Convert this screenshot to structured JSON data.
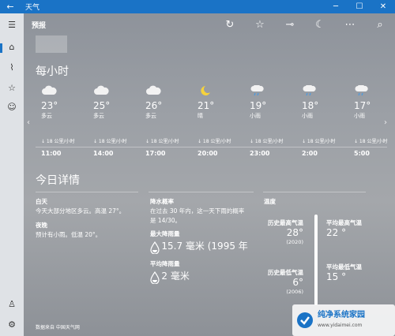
{
  "titlebar": {
    "back": "←",
    "title": "天气",
    "minimize": "─",
    "maximize": "☐",
    "close": "✕"
  },
  "toolbar": {
    "label": "预报"
  },
  "hourly": {
    "title": "每小时",
    "items": [
      {
        "temp": "23°",
        "cond": "多云",
        "wind": "↓ 18 公里/小时",
        "time": "11:00",
        "icon": "cloud-icon"
      },
      {
        "temp": "25°",
        "cond": "多云",
        "wind": "↓ 18 公里/小时",
        "time": "14:00",
        "icon": "cloud-icon"
      },
      {
        "temp": "26°",
        "cond": "多云",
        "wind": "↓ 18 公里/小时",
        "time": "17:00",
        "icon": "cloud-icon"
      },
      {
        "temp": "21°",
        "cond": "晴",
        "wind": "↓ 18 公里/小时",
        "time": "20:00",
        "icon": "moon-icon"
      },
      {
        "temp": "19°",
        "cond": "小雨",
        "wind": "↓ 18 公里/小时",
        "time": "23:00",
        "icon": "rain-icon"
      },
      {
        "temp": "18°",
        "cond": "小雨",
        "wind": "↓ 18 公里/小时",
        "time": "2:00",
        "icon": "rain-icon"
      },
      {
        "temp": "17°",
        "cond": "小雨",
        "wind": "↓ 18 公里/小时",
        "time": "5:00",
        "icon": "rain-icon"
      }
    ]
  },
  "today": {
    "title": "今日详情",
    "day_label": "白天",
    "day_text": "今天大部分地区多云。高温 27°。",
    "night_label": "夜晚",
    "night_text": "预计有小雨。低温 20°。",
    "precip_label": "降水概率",
    "precip_text_1": "在过去 30 年内，这一天下雨的概率",
    "precip_text_2": "是 14/30。",
    "max_rain_label": "最大降雨量",
    "max_rain_value": "15.7 毫米 (1995 年",
    "avg_rain_label": "平均降雨量",
    "avg_rain_value": "2 毫米",
    "temp_label": "温度",
    "hist_high_label": "历史最高气温",
    "hist_high_value": "28°",
    "hist_high_year": "(2020)",
    "avg_high_label": "平均最高气温",
    "avg_high_value": "22 °",
    "hist_low_label": "历史最低气温",
    "hist_low_value": "6°",
    "hist_low_year": "(2006)",
    "avg_low_label": "平均最低气温",
    "avg_low_value": "15 °"
  },
  "footer": {
    "source": "数据来自 中国天气网"
  },
  "watermark": {
    "name": "纯净系统家园",
    "url": "www.yidaimei.com"
  }
}
